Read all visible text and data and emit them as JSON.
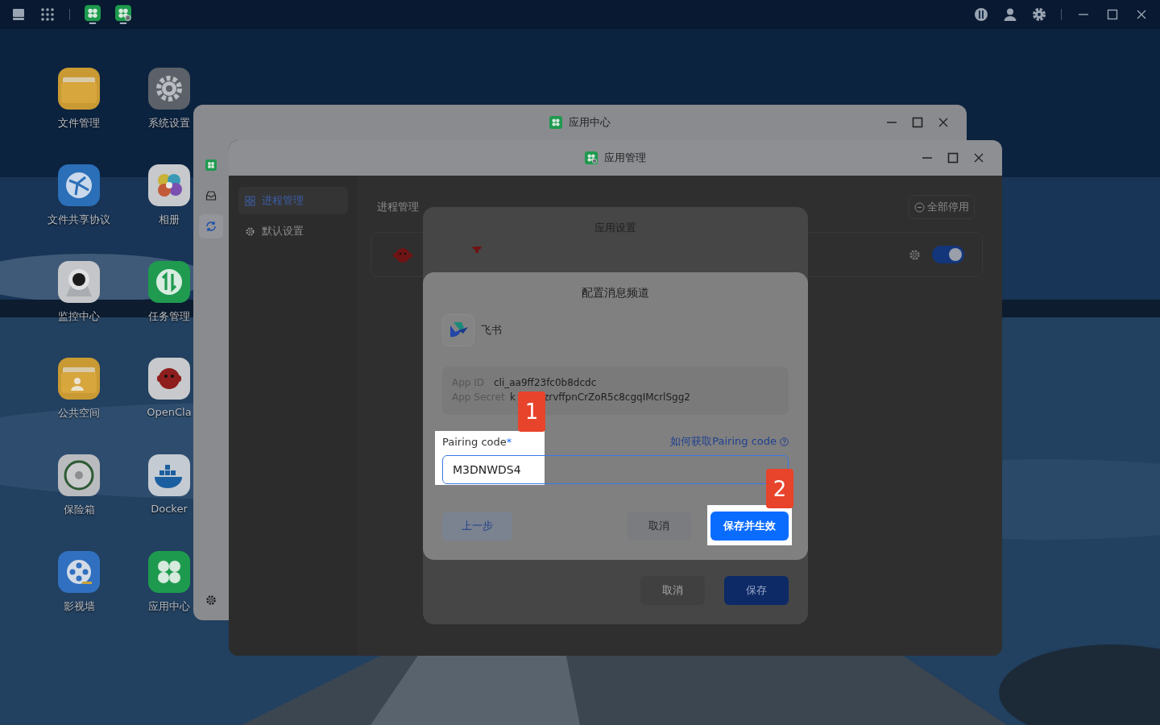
{
  "desktop_icons": [
    "文件管理",
    "系统设置",
    "文件共享协议",
    "相册",
    "监控中心",
    "任务管理",
    "公共空间",
    "OpenCla",
    "保险箱",
    "Docker",
    "影视墙",
    "应用中心"
  ],
  "app_center_window": {
    "title": "应用中心"
  },
  "app_manager_window": {
    "title": "应用管理",
    "sidebar": [
      {
        "label": "进程管理",
        "selected": true
      },
      {
        "label": "默认设置",
        "selected": false
      }
    ],
    "heading": "进程管理",
    "stop_all_button": "全部停用",
    "processes": [
      {
        "on": true
      }
    ]
  },
  "app_settings_dialog": {
    "title": "应用设置",
    "buttons": [
      {
        "label": "取消",
        "kind": "secondary"
      },
      {
        "label": "保存",
        "kind": "primary"
      }
    ]
  },
  "channel_dialog": {
    "title": "配置消息频道",
    "channel": "飞书",
    "app_id_label": "App ID",
    "app_id": "cli_aa9ff23fc0b8dcdc",
    "app_secret_label": "App Secret",
    "app_secret_parts": [
      "k",
      "zrvffpnCrZoR5c8cgqIMcrlSgg2"
    ],
    "pairing_label": "Pairing code",
    "required_mark": "*",
    "help_link": "如何获取Pairing code",
    "pairing_value": "M3DNWDS4",
    "pairing_highlighted": true,
    "buttons": [
      {
        "label": "上一步",
        "kind": "back",
        "highlighted": false
      },
      {
        "label": "取消",
        "kind": "secondary",
        "highlighted": false
      },
      {
        "label": "保存并生效",
        "kind": "primary",
        "highlighted": true
      }
    ]
  },
  "step_badges": [
    "1",
    "2"
  ]
}
